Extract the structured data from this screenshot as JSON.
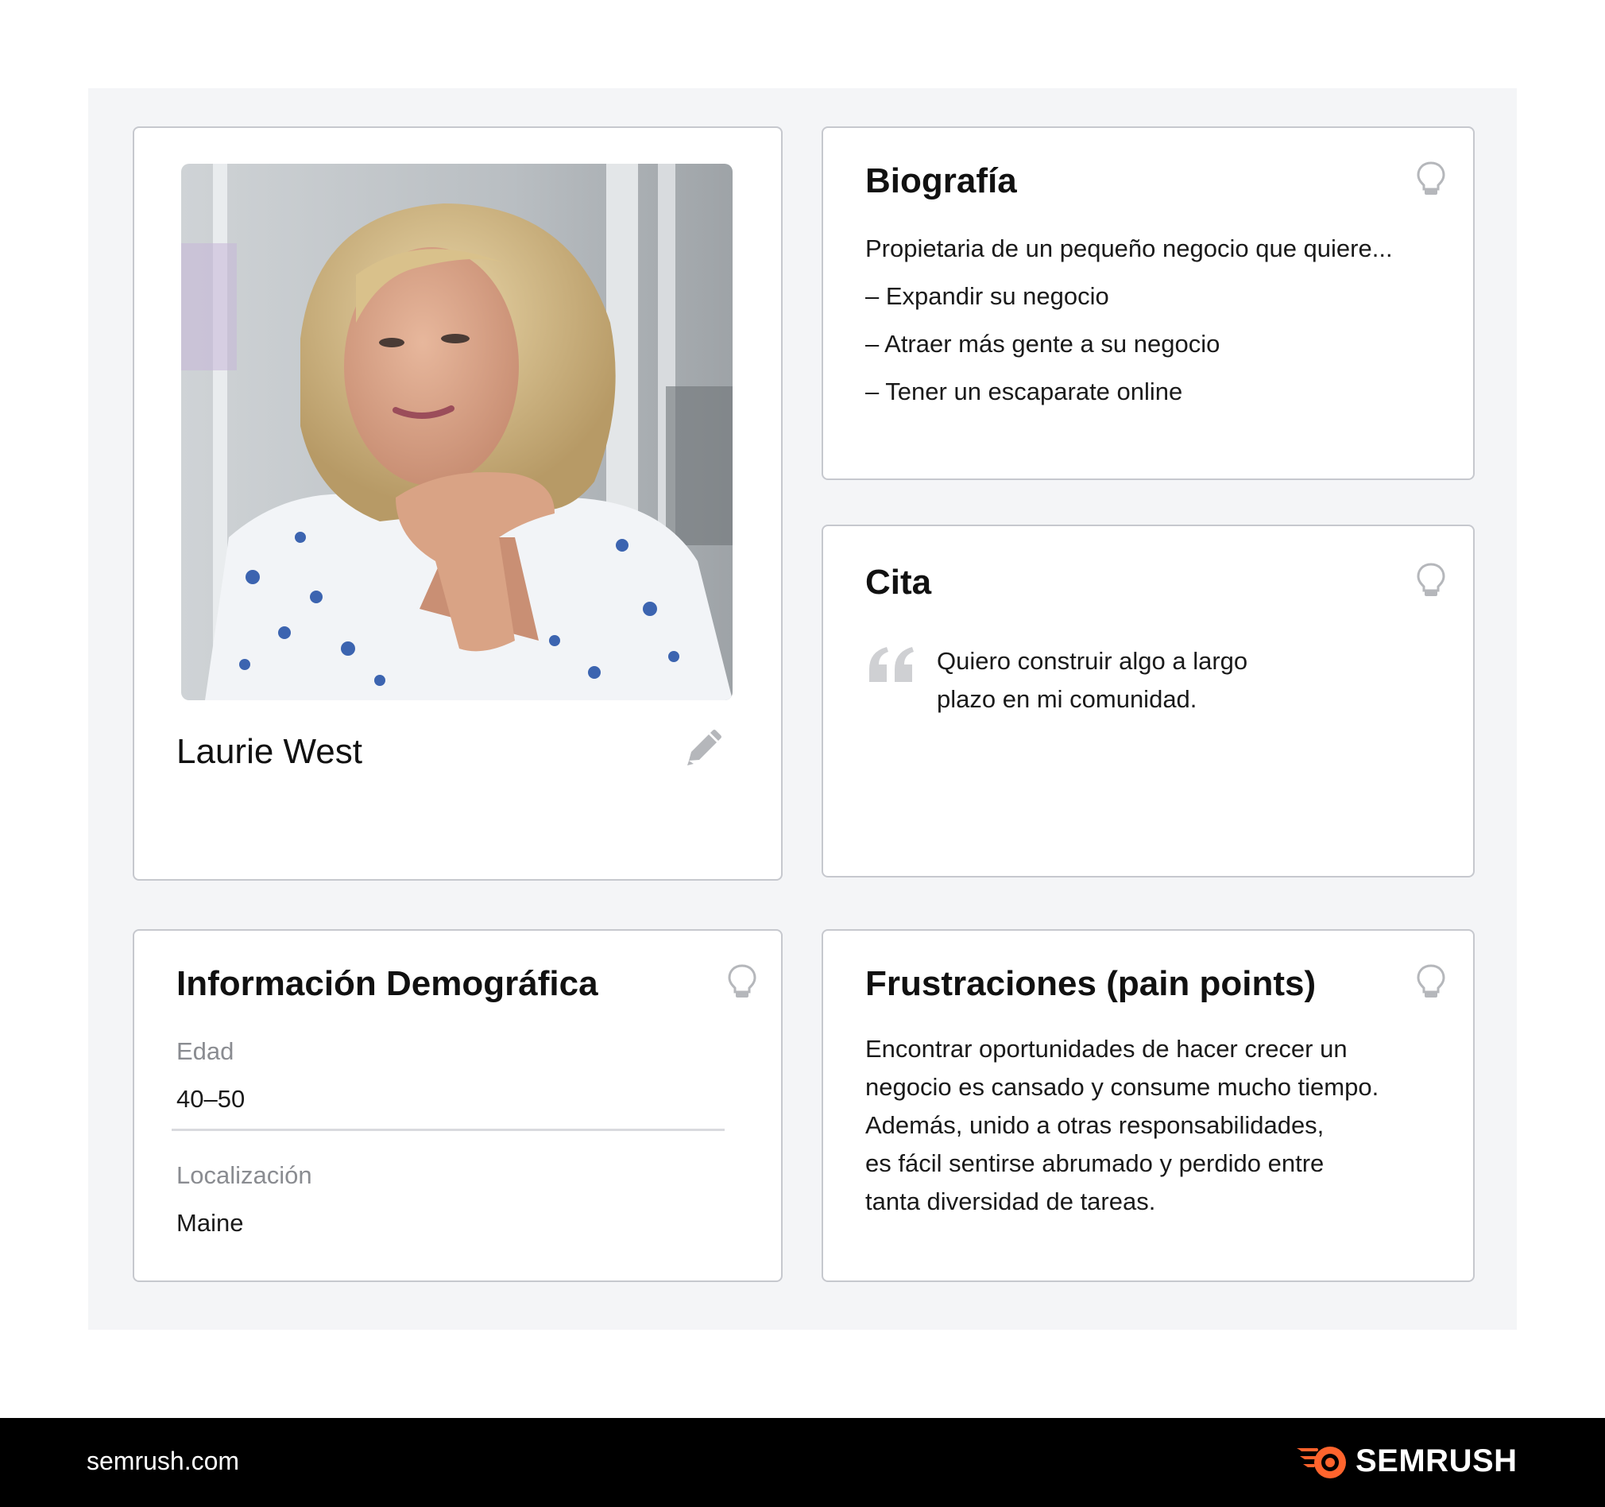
{
  "profile": {
    "name": "Laurie West",
    "photo_icon": "portrait-photo",
    "edit_icon": "pencil-icon"
  },
  "biography": {
    "title": "Biografía",
    "intro": "Propietaria de un pequeño negocio que quiere...",
    "items": [
      "– Expandir su negocio",
      "– Atraer más gente a su negocio",
      "– Tener un escaparate online"
    ],
    "icon": "lightbulb-icon"
  },
  "quote": {
    "title": "Cita",
    "lines": [
      "Quiero construir algo a largo",
      "plazo en mi comunidad."
    ],
    "icon": "lightbulb-icon"
  },
  "demographics": {
    "title": "Información Demográfica",
    "fields": [
      {
        "label": "Edad",
        "value": "40–50"
      },
      {
        "label": "Localización",
        "value": "Maine"
      }
    ],
    "icon": "lightbulb-icon"
  },
  "frustrations": {
    "title": "Frustraciones (pain points)",
    "lines": [
      "Encontrar oportunidades de hacer crecer un",
      "negocio es cansado y consume mucho tiempo.",
      "Además, unido a otras responsabilidades,",
      "es fácil sentirse abrumado y perdido entre",
      "tanta diversidad de tareas."
    ],
    "icon": "lightbulb-icon"
  },
  "footer": {
    "url": "semrush.com",
    "brand": "SEMRUSH",
    "brand_color": "#ff642d"
  },
  "colors": {
    "canvas_bg": "#f4f5f7",
    "card_border": "#c6c8ce",
    "icon_gray": "#b5b7bb",
    "label_gray": "#8a8c91"
  }
}
